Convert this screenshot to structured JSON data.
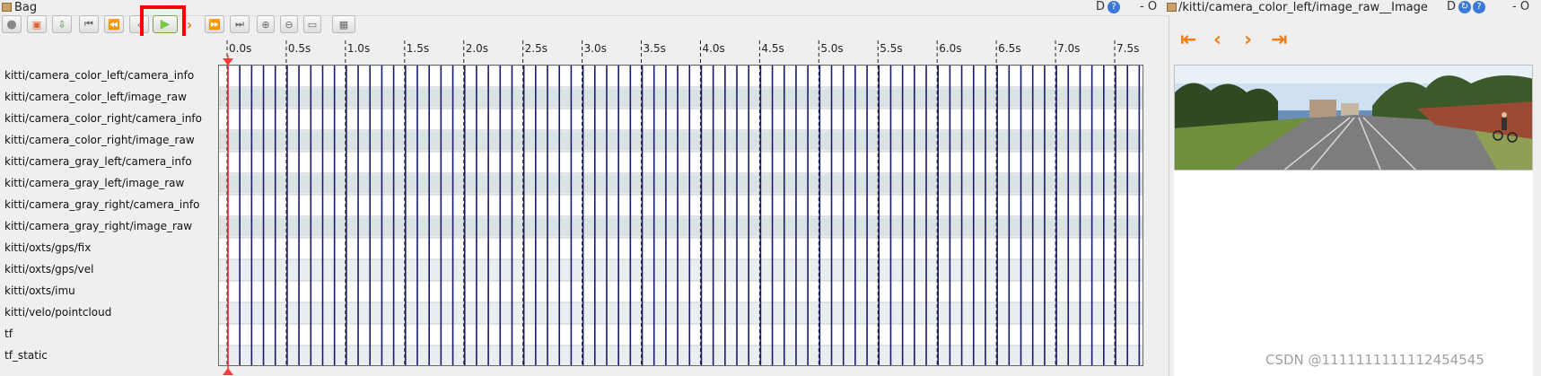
{
  "window": {
    "title": "Bag",
    "controls_left": "D",
    "controls_right_text": "- O",
    "close_right": "- O",
    "image_title": "/kitti/camera_color_left/image_raw__Image",
    "image_controls": "D"
  },
  "toolbar": {
    "buttons": [
      {
        "name": "record-button",
        "glyph": "●"
      },
      {
        "name": "open-button",
        "glyph": "▣"
      },
      {
        "name": "save-button",
        "glyph": "⇩"
      },
      {
        "name": "skip-begin-button",
        "glyph": "⏮"
      },
      {
        "name": "rewind-button",
        "glyph": "⏪"
      },
      {
        "name": "step-back-button",
        "glyph": "‹"
      },
      {
        "name": "play-button",
        "glyph": "▶"
      },
      {
        "name": "step-forward-button",
        "glyph": "›"
      },
      {
        "name": "fast-forward-button",
        "glyph": "⏩"
      },
      {
        "name": "skip-end-button",
        "glyph": "⏭"
      },
      {
        "name": "zoom-in-button",
        "glyph": "⊕"
      },
      {
        "name": "zoom-reset-button",
        "glyph": "⊖"
      },
      {
        "name": "zoom-fit-button",
        "glyph": "▭"
      },
      {
        "name": "thumbnails-button",
        "glyph": "▦"
      }
    ]
  },
  "timeline": {
    "ticks": [
      "0.0s",
      "0.5s",
      "1.0s",
      "1.5s",
      "2.0s",
      "2.5s",
      "3.0s",
      "3.5s",
      "4.0s",
      "4.5s",
      "5.0s",
      "5.5s",
      "6.0s",
      "6.5s",
      "7.0s",
      "7.5s"
    ],
    "tick_values": [
      0,
      0.5,
      1,
      1.5,
      2,
      2.5,
      3,
      3.5,
      4,
      4.5,
      5,
      5.5,
      6,
      6.5,
      7,
      7.5
    ],
    "range": [
      -0.1,
      7.8
    ],
    "playhead": 0.0,
    "topics": [
      "kitti/camera_color_left/camera_info",
      "kitti/camera_color_left/image_raw",
      "kitti/camera_color_right/camera_info",
      "kitti/camera_color_right/image_raw",
      "kitti/camera_gray_left/camera_info",
      "kitti/camera_gray_left/image_raw",
      "kitti/camera_gray_right/camera_info",
      "kitti/camera_gray_right/image_raw",
      "kitti/oxts/gps/fix",
      "kitti/oxts/gps/vel",
      "kitti/oxts/imu",
      "kitti/velo/pointcloud",
      "tf",
      "tf_static"
    ]
  },
  "image_nav": {
    "first": "⇤",
    "prev": "‹",
    "next": "›",
    "last": "⇥"
  },
  "colors": {
    "accent": "#f07f1b",
    "play_green": "#7ac943",
    "highlight": "#ff0000",
    "message_mark": "#1a1a6e",
    "image_mark": "#2f6b5a",
    "playhead": "#ff3b3b"
  },
  "watermark": "CSDN @1111111111112454545"
}
